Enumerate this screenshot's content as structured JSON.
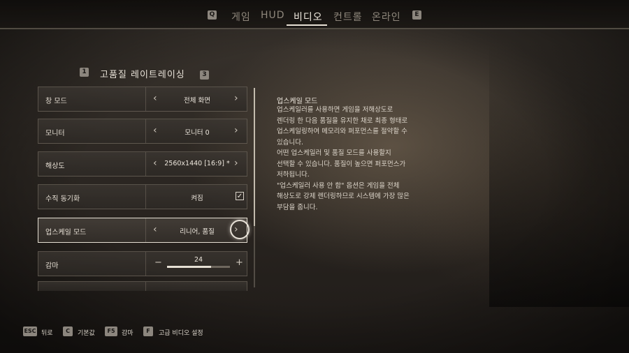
{
  "tabs": {
    "prev_key": "Q",
    "next_key": "E",
    "items": [
      {
        "label": "게임"
      },
      {
        "label": "HUD"
      },
      {
        "label": "비디오"
      },
      {
        "label": "컨트롤"
      },
      {
        "label": "온라인"
      }
    ],
    "active": "비디오"
  },
  "section": {
    "prev_key": "1",
    "next_key": "3",
    "title": "고품질 레이트레이싱"
  },
  "settings": [
    {
      "label": "창 모드",
      "value": "전체 화면",
      "control": "selector"
    },
    {
      "label": "모니터",
      "value": "모니터 0",
      "control": "selector"
    },
    {
      "label": "해상도",
      "value": "2560x1440 [16:9] *",
      "control": "selector"
    },
    {
      "label": "수직 동기화",
      "value": "켜짐",
      "control": "checkbox",
      "checked": true
    },
    {
      "label": "업스케일 모드",
      "value": "리니어, 품질",
      "control": "selector",
      "selected": true
    },
    {
      "label": "감마",
      "value": "24",
      "control": "slider",
      "level": 0.7
    }
  ],
  "description": {
    "title": "업스케일 모드",
    "body": "업스케일러를 사용하면 게임을 저해상도로\n렌더링 한 다음 품질을 유지한 채로 최종 형태로\n업스케일링하여 메모리와 퍼포먼스를 절약할 수\n있습니다.\n어떤 업스케일러 및 품질 모드를 사용할지\n선택할 수 있습니다. 품질이 높으면 퍼포먼스가\n저하됩니다.\n\"업스케일러 사용 안 함\" 옵션은 게임을 전체\n해상도로 강제 렌더링하므로 시스템에 가장 많은\n부담을 줍니다."
  },
  "footer": [
    {
      "key": "ESC",
      "label": "뒤로"
    },
    {
      "key": "C",
      "label": "기본값"
    },
    {
      "key": "F5",
      "label": "감마"
    },
    {
      "key": "F",
      "label": "고급 비디오 설정"
    }
  ],
  "icons": {
    "arrow_left": "‹",
    "arrow_right": "›",
    "check": "✓",
    "minus": "−",
    "plus": "+"
  }
}
